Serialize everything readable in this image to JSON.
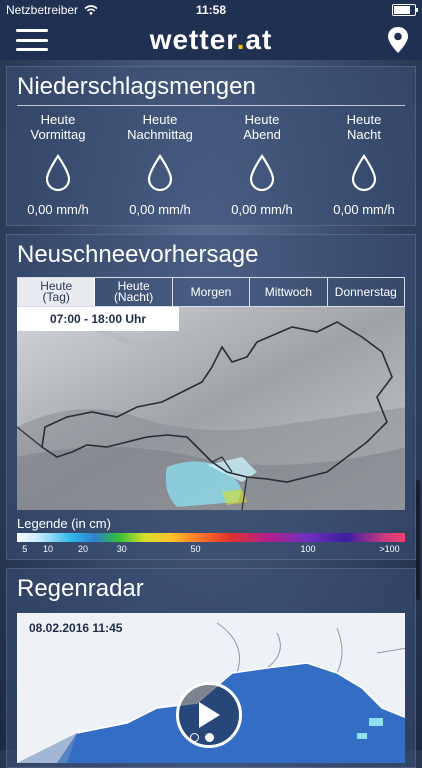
{
  "status_bar": {
    "carrier": "Netzbetreiber",
    "time": "11:58",
    "battery_level": 0.9
  },
  "header": {
    "logo_main": "wetter",
    "logo_dot": ".",
    "logo_tld": "at"
  },
  "precipitation": {
    "title": "Niederschlagsmengen",
    "items": [
      {
        "line1": "Heute",
        "line2": "Vormittag",
        "value": "0,00 mm/h"
      },
      {
        "line1": "Heute",
        "line2": "Nachmittag",
        "value": "0,00 mm/h"
      },
      {
        "line1": "Heute",
        "line2": "Abend",
        "value": "0,00 mm/h"
      },
      {
        "line1": "Heute",
        "line2": "Nacht",
        "value": "0,00 mm/h"
      }
    ]
  },
  "snow_forecast": {
    "title": "Neuschneevorhersage",
    "tabs": [
      {
        "line1": "Heute",
        "line2": "(Tag)"
      },
      {
        "line1": "Heute",
        "line2": "(Nacht)"
      },
      {
        "line1": "Morgen",
        "line2": ""
      },
      {
        "line1": "Mittwoch",
        "line2": ""
      },
      {
        "line1": "Donnerstag",
        "line2": ""
      }
    ],
    "time_range": "07:00 - 18:00 Uhr",
    "legend_title": "Legende (in cm)",
    "legend_ticks": [
      {
        "label": "5",
        "pos": 2
      },
      {
        "label": "10",
        "pos": 8
      },
      {
        "label": "20",
        "pos": 17
      },
      {
        "label": "30",
        "pos": 27
      },
      {
        "label": "50",
        "pos": 46
      },
      {
        "label": "100",
        "pos": 75
      },
      {
        "label": ">100",
        "pos": 96
      }
    ]
  },
  "radar": {
    "title": "Regenradar",
    "timestamp": "08.02.2016 11:45"
  },
  "colors": {
    "header_bg": "#1f3052",
    "accent_yellow": "#f2c400",
    "active_tab": "#e8ebef"
  }
}
